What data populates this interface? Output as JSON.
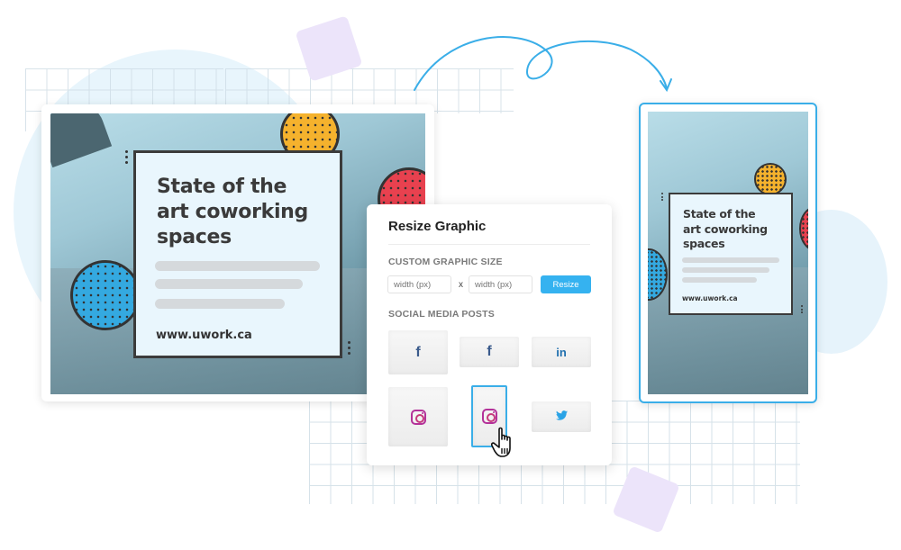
{
  "panel": {
    "title": "Resize Graphic",
    "custom_size_label": "CUSTOM GRAPHIC SIZE",
    "width_input": {
      "placeholder": "width (px)",
      "value": ""
    },
    "height_input": {
      "placeholder": "width (px)",
      "value": ""
    },
    "separator": "x",
    "resize_button": "Resize",
    "social_label": "SOCIAL MEDIA POSTS",
    "tiles": [
      {
        "icon": "facebook-icon",
        "glyph": "f",
        "format": "facebook-square"
      },
      {
        "icon": "facebook-icon",
        "glyph": "f",
        "format": "facebook-landscape"
      },
      {
        "icon": "linkedin-icon",
        "glyph": "in",
        "format": "linkedin"
      },
      {
        "icon": "instagram-icon",
        "glyph": "",
        "format": "instagram-square"
      },
      {
        "icon": "instagram-icon",
        "glyph": "",
        "format": "instagram-story",
        "selected": true
      },
      {
        "icon": "twitter-icon",
        "glyph": "🐦",
        "format": "twitter"
      }
    ]
  },
  "graphic": {
    "headline_line1": "State of the",
    "headline_line2": "art coworking",
    "headline_line3": "spaces",
    "url": "www.uwork.ca"
  },
  "colors": {
    "accent": "#35b2f0",
    "circle_yellow": "#f5b22d",
    "circle_red": "#e8414f",
    "circle_blue": "#34a9e0",
    "text_box": "#e9f6fd"
  }
}
